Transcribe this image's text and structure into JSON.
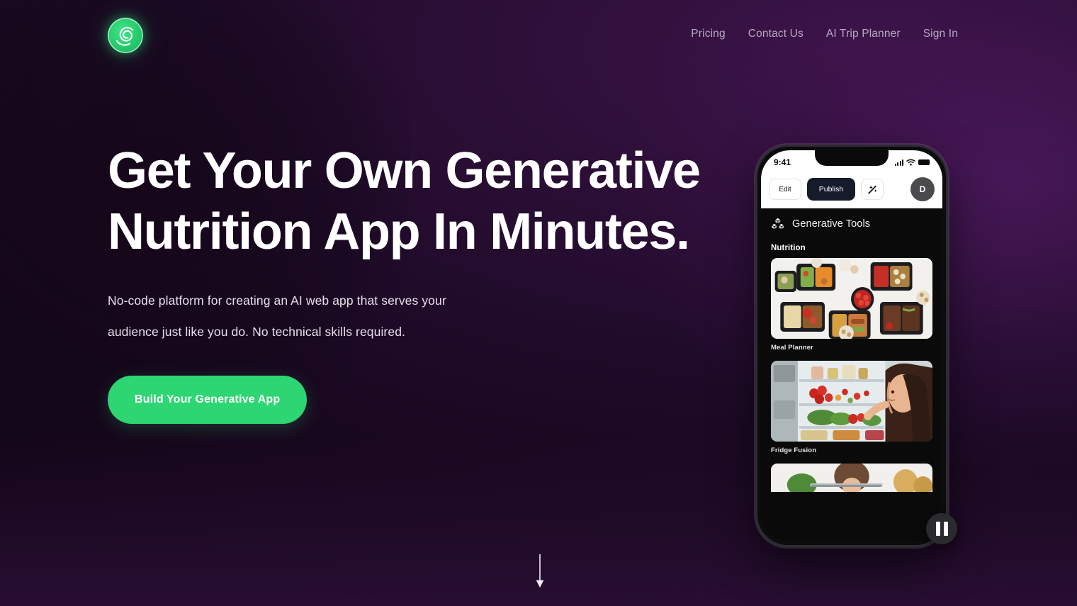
{
  "theme": {
    "bg_dark": "#17091b",
    "bg_purple": "#331340",
    "accent_green": "#2ed573",
    "nav_link_color": "#b9a7c4",
    "headline_color": "#ffffff"
  },
  "header": {
    "logo_name": "brand-logo",
    "links": [
      {
        "label": "Pricing"
      },
      {
        "label": "Contact Us"
      },
      {
        "label": "AI Trip Planner"
      },
      {
        "label": "Sign In"
      }
    ]
  },
  "hero": {
    "headline": "Get Your Own Generative\nNutrition App In Minutes.",
    "subhead": "No-code platform for creating an AI web app that serves your\naudience just like you do. No technical skills required.",
    "cta_label": "Build Your Generative App",
    "scroll_hint_icon": "arrow-down-icon"
  },
  "phone": {
    "status_bar": {
      "time": "9:41",
      "icons": [
        "cellular-signal-icon",
        "wifi-icon",
        "battery-icon"
      ]
    },
    "toolbar": {
      "edit_label": "Edit",
      "publish_label": "Publish",
      "magic_icon": "magic-wand-sparkle-icon",
      "avatar_initial": "D"
    },
    "app": {
      "tools_icon": "cubes-icon",
      "tools_label": "Generative Tools",
      "section_title": "Nutrition",
      "cards": [
        {
          "label": "Meal Planner",
          "image": "meal-prep-containers-photo"
        },
        {
          "label": "Fridge Fusion",
          "image": "woman-at-open-fridge-photo"
        },
        {
          "label": "",
          "image": "cooking-video-photo"
        }
      ]
    },
    "pause_button": "pause-icon"
  }
}
